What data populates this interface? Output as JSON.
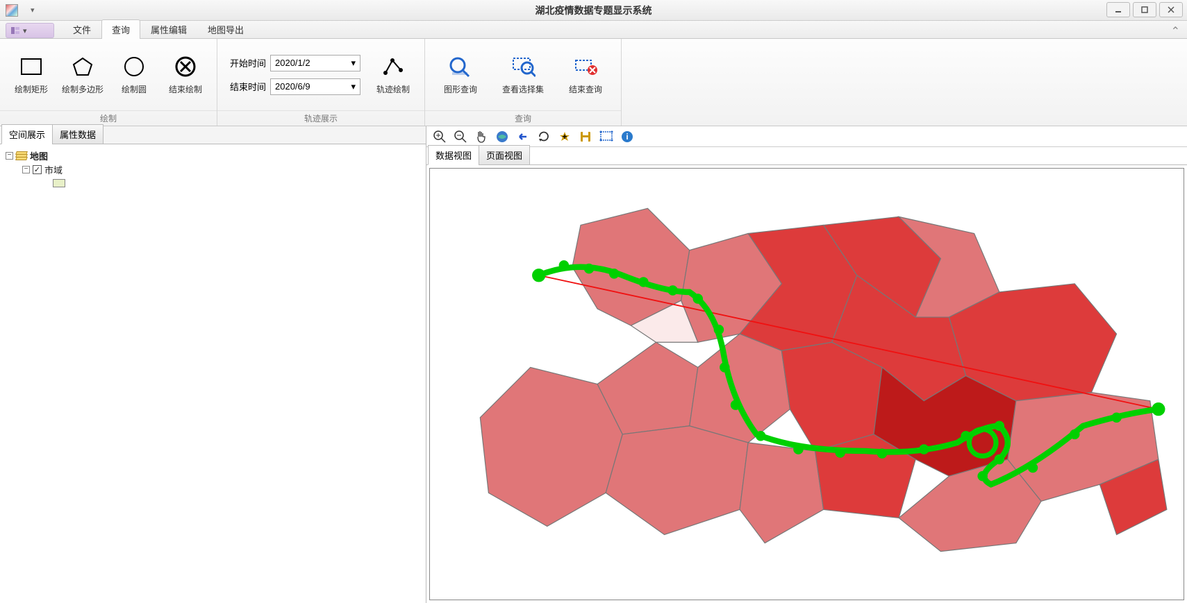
{
  "window": {
    "title": "湖北疫情数据专题显示系统"
  },
  "tabs": {
    "file": "文件",
    "query": "查询",
    "attr_edit": "属性编辑",
    "map_export": "地图导出"
  },
  "ribbon": {
    "draw_group": "绘制",
    "draw_rect": "绘制矩形",
    "draw_poly": "绘制多边形",
    "draw_circle": "绘制圆",
    "end_draw": "结束绘制",
    "track_group": "轨迹展示",
    "start_time_label": "开始时间",
    "end_time_label": "结束时间",
    "start_time": "2020/1/2",
    "end_time": "2020/6/9",
    "track_draw": "轨迹绘制",
    "query_group": "查询",
    "graphic_query": "图形查询",
    "view_selection": "查看选择集",
    "end_query": "结束查询"
  },
  "left_tabs": {
    "spatial": "空间展示",
    "attr": "属性数据"
  },
  "tree": {
    "root": "地图",
    "layer": "市域"
  },
  "map_tabs": {
    "data_view": "数据视图",
    "page_view": "页面视图"
  },
  "map_toolbar_icons": [
    "zoom-in",
    "zoom-out",
    "pan",
    "full-extent",
    "prev-extent",
    "next-extent",
    "add",
    "save",
    "select-all",
    "identify"
  ]
}
